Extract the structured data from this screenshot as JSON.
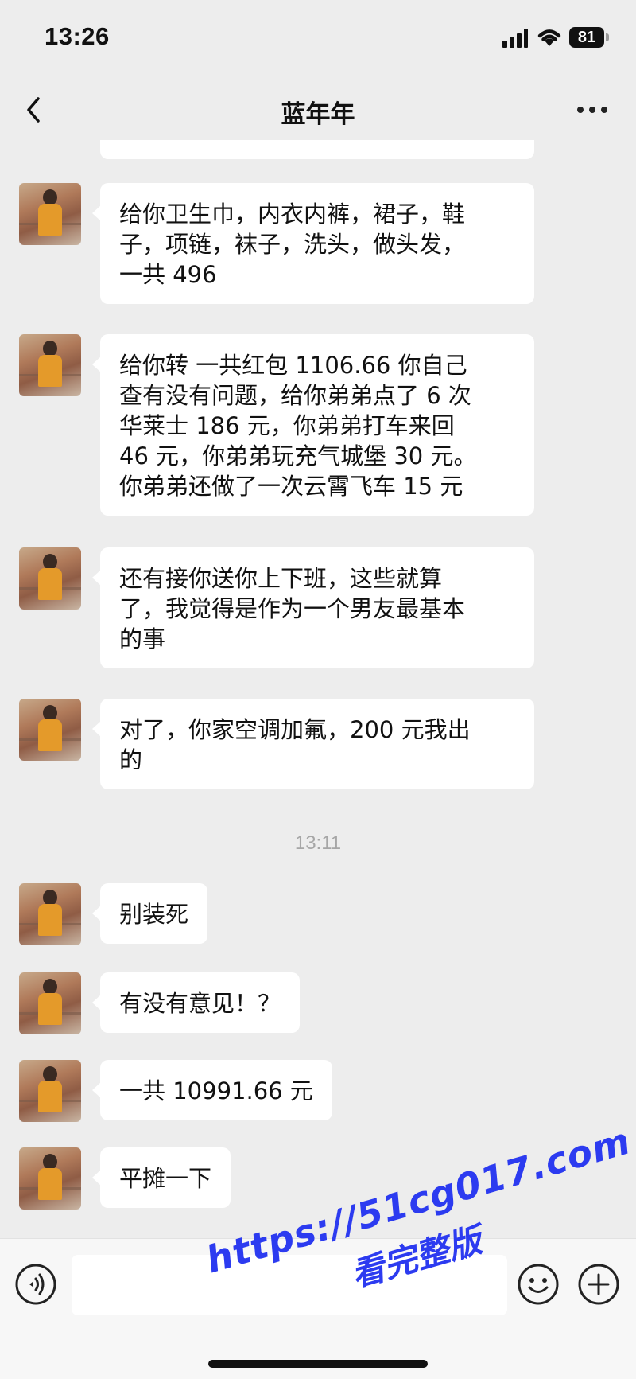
{
  "status_bar": {
    "time": "13:26",
    "battery": "81"
  },
  "nav": {
    "title": "蓝年年"
  },
  "messages": [
    {
      "text": "给你卫生巾，内衣内裤，裙子，鞋\n子，项链，袜子，洗头，做头发，\n一共 496"
    },
    {
      "text": "给你转 一共红包 1106.66 你自己\n查有没有问题，给你弟弟点了 6 次\n华莱士 186 元，你弟弟打车来回\n46 元，你弟弟玩充气城堡 30 元。\n你弟弟还做了一次云霄飞车 15 元"
    },
    {
      "text": "还有接你送你上下班，这些就算\n了，我觉得是作为一个男友最基本\n的事"
    },
    {
      "text": "对了，你家空调加氟，200 元我出\n的"
    },
    {
      "text": "别装死"
    },
    {
      "text": "有没有意见！？"
    },
    {
      "text": "一共 10991.66 元"
    },
    {
      "text": "平摊一下"
    }
  ],
  "timestamp": "13:11",
  "icons": {
    "back": "chevron-left-icon",
    "more": "more-dots-icon",
    "voice": "voice-icon",
    "emoji": "emoji-icon",
    "plus": "plus-icon"
  },
  "colors": {
    "chat_bg": "#ededed",
    "bubble": "#ffffff",
    "watermark": "#2c3bf0"
  },
  "watermark": {
    "url": "https://51cg017.com",
    "label": "看完整版"
  }
}
